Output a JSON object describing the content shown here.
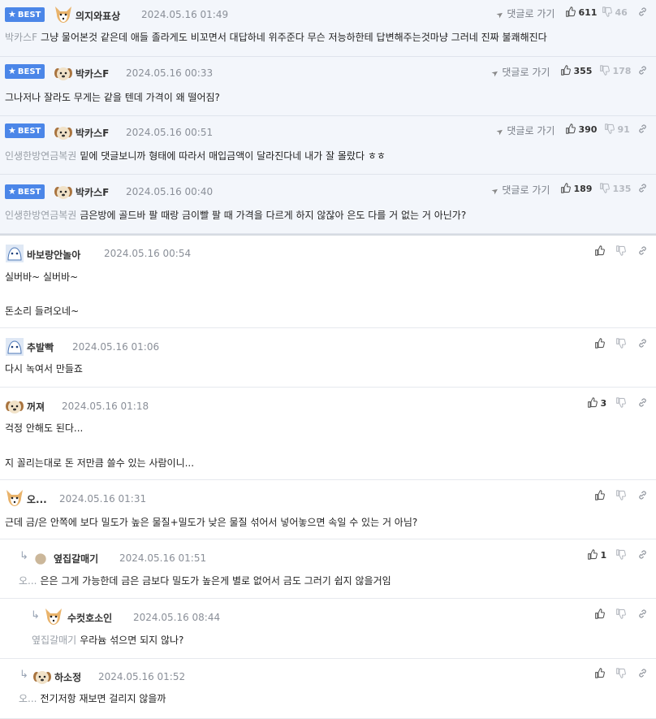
{
  "labels": {
    "best": "BEST",
    "reply_link": "댓글로 가기"
  },
  "best_comments": [
    {
      "nick": "의지와표상",
      "time": "2024.05.16 01:49",
      "up": "611",
      "down": "46",
      "to": "박카스F",
      "text": "그냥 물어본것 같은데 애들 졸라게도 비꼬면서 대답하네 위주준다 무슨 저능하한테 답변해주는것마냥 그러네 진짜 불쾌해진다"
    },
    {
      "nick": "박카스F",
      "time": "2024.05.16 00:33",
      "up": "355",
      "down": "178",
      "to": "",
      "text": "그나저나 잘라도 무게는 같을 텐데 가격이 왜 떨어짐?"
    },
    {
      "nick": "박카스F",
      "time": "2024.05.16 00:51",
      "up": "390",
      "down": "91",
      "to": "인생한방연금복권",
      "text": "밑에 댓글보니까 형태에 따라서 매입금액이 달라진다네 내가 잘 몰랐다 ㅎㅎ"
    },
    {
      "nick": "박카스F",
      "time": "2024.05.16 00:40",
      "up": "189",
      "down": "135",
      "to": "인생한방연금복권",
      "text": "금은방에 골드바 팔 때랑 금이빨 팔 때 가격을 다르게 하지 않잖아 은도 다를 거 없는 거 아닌가?"
    }
  ],
  "comments": [
    {
      "nick": "바보랑안놀아",
      "time": "2024.05.16 00:54",
      "up": "",
      "line1": "실버바~ 실버바~",
      "line2": "돈소리 들려오네~"
    },
    {
      "nick": "추발빡",
      "time": "2024.05.16 01:06",
      "up": "",
      "line1": "다시 녹여서 만들죠"
    },
    {
      "nick": "꺼져",
      "time": "2024.05.16 01:18",
      "up": "3",
      "line1": "걱정 안해도 된다...",
      "line2": "지 꼴리는대로 돈 저만큼 쓸수 있는 사람이니..."
    },
    {
      "nick": "오...",
      "time": "2024.05.16 01:31",
      "up": "",
      "line1": "근데 금/은 안쪽에 보다 밀도가 높은 물질+밀도가 낮은 물질 섞어서 넣어놓으면 속일 수 있는 거 아님?"
    }
  ],
  "replies": [
    {
      "nick": "옆집갈매기",
      "time": "2024.05.16 01:51",
      "up": "1",
      "to": "오...",
      "text": "은은 그게 가능한데 금은 금보다 밀도가 높은게 별로 없어서 금도 그러기 쉽지 않을거임"
    },
    {
      "nick": "수컷호소인",
      "time": "2024.05.16 08:44",
      "up": "",
      "to": "옆집갈매기",
      "text": "우라늄 섞으면 되지 않나?"
    },
    {
      "nick": "하소정",
      "time": "2024.05.16 01:52",
      "up": "",
      "to": "오...",
      "text": "전기저항 재보면 걸리지 않을까"
    }
  ],
  "colors": {
    "best_badge": "#4b86e8",
    "best_bg": "#f3f6fb"
  },
  "icons": [
    "star-icon",
    "reply-arrow-icon",
    "thumb-up-icon",
    "thumb-down-icon",
    "share-link-icon",
    "reply-indent-icon",
    "dog-avatar-icon",
    "puppy-avatar-icon",
    "blank-avatar-icon"
  ]
}
